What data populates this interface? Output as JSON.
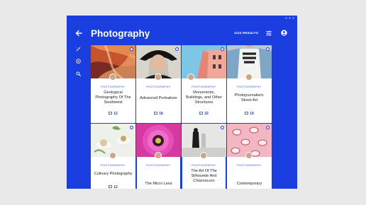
{
  "header": {
    "title": "Photography",
    "results": "1124 RESULTS"
  },
  "colors": {
    "brand": "#1a3ee0",
    "background": "#e9e9ea",
    "card": "#ffffff"
  },
  "icons": {
    "back": "arrow-left-icon",
    "filter": "tune-icon",
    "profile": "account-circle-icon",
    "sidebar": [
      "magic-wand-icon",
      "coin-icon",
      "search-icon"
    ],
    "card_badge": "plus-circle-icon",
    "count": "comment-icon"
  },
  "cards": [
    {
      "category": "PHOTOGRAPHY",
      "title": "Geological Photography Of The Southwest",
      "count": "12"
    },
    {
      "category": "PHOTOGRAPHY",
      "title": "Advanced Portraiture",
      "count": "18"
    },
    {
      "category": "PHOTOGRAPHY",
      "title": "Monuments, Buildings, and Other Structures",
      "count": "22"
    },
    {
      "category": "PHOTOGRAPHY",
      "title": "Photojournalism: Street Art",
      "count": "19"
    },
    {
      "category": "PHOTOGRAPHY",
      "title": "Culinary Photography",
      "count": "12"
    },
    {
      "category": "PHOTOGRAPHY",
      "title": "The Micro Lens",
      "count": ""
    },
    {
      "category": "PHOTOGRAPHY",
      "title": "The Art Of The Silhouette And Chiaroscuro",
      "count": ""
    },
    {
      "category": "PHOTOGRAPHY",
      "title": "Contemporary",
      "count": ""
    }
  ]
}
